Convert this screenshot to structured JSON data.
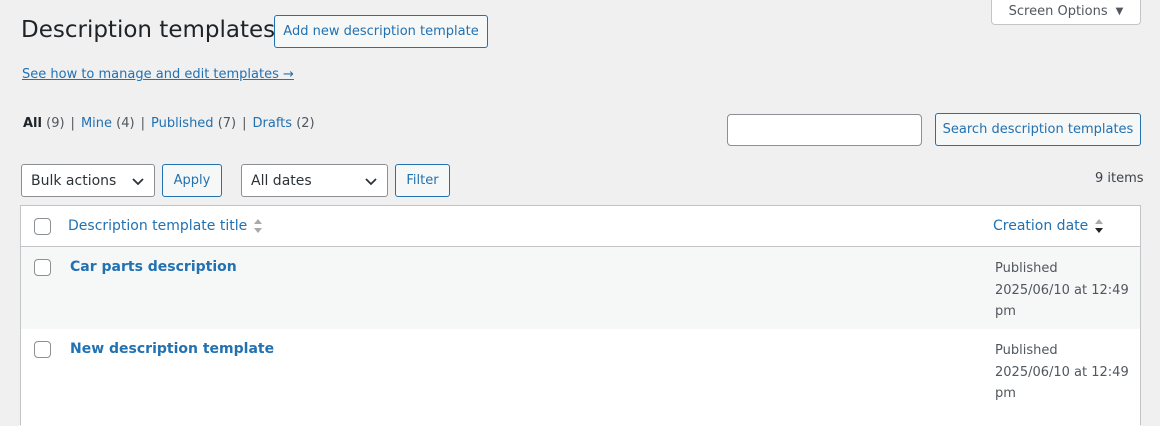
{
  "screen_options": {
    "label": "Screen Options",
    "caret": "▼"
  },
  "header": {
    "title": "Description templates",
    "add_new_label": "Add new description template",
    "howto_link": "See how to manage and edit templates →"
  },
  "views": [
    {
      "label": "All",
      "count": "(9)",
      "current": true
    },
    {
      "label": "Mine",
      "count": "(4)"
    },
    {
      "label": "Published",
      "count": "(7)"
    },
    {
      "label": "Drafts",
      "count": "(2)"
    }
  ],
  "search": {
    "value": "",
    "button_label": "Search description templates"
  },
  "tablenav": {
    "bulk_actions": "Bulk actions",
    "apply_label": "Apply",
    "dates": "All dates",
    "filter_label": "Filter",
    "items_count": "9 items"
  },
  "table": {
    "columns": {
      "title": "Description template title",
      "date": "Creation date"
    },
    "rows": [
      {
        "title": "Car parts description",
        "status": "Published",
        "date": "2025/06/10 at 12:49",
        "time_suffix": "pm"
      },
      {
        "title": "New description template",
        "status": "Published",
        "date": "2025/06/10 at 12:49",
        "time_suffix": "pm"
      }
    ]
  },
  "colors": {
    "accent": "#2271b1",
    "background": "#f0f0f1",
    "text": "#1d2327"
  }
}
